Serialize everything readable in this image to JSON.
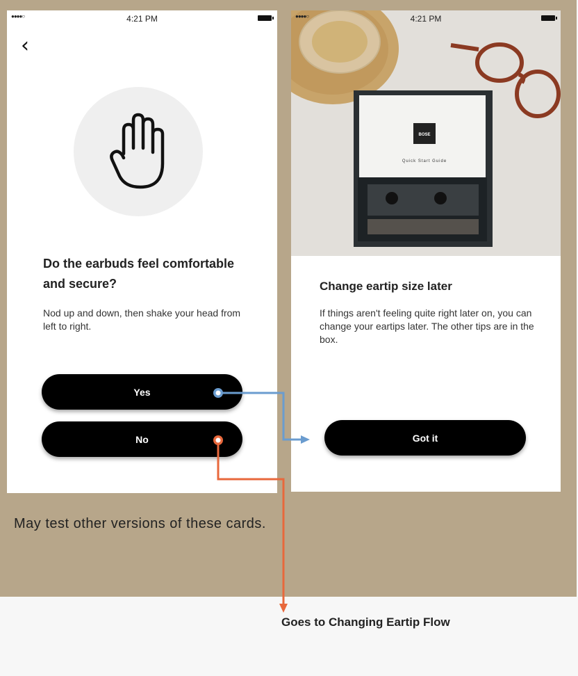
{
  "left_screen": {
    "status_time": "4:21 PM",
    "title": "Do the earbuds feel comfortable and secure?",
    "body": "Nod up and down, then shake your head from left to right.",
    "yes_label": "Yes",
    "no_label": "No"
  },
  "right_screen": {
    "status_time": "4:21 PM",
    "guide_logo": "BOSE",
    "guide_text": "Quick Start Guide",
    "title": "Change eartip size later",
    "body": "If things aren't feeling quite right later on, you can change your eartips later. The other tips are in the box.",
    "got_it_label": "Got it"
  },
  "annotations": {
    "note": "May test other versions of these cards.",
    "no_destination": "Goes to Changing Eartip Flow"
  },
  "colors": {
    "board": "#b7a68a",
    "yes_flow": "#6a9ccf",
    "no_flow": "#e8683c"
  }
}
